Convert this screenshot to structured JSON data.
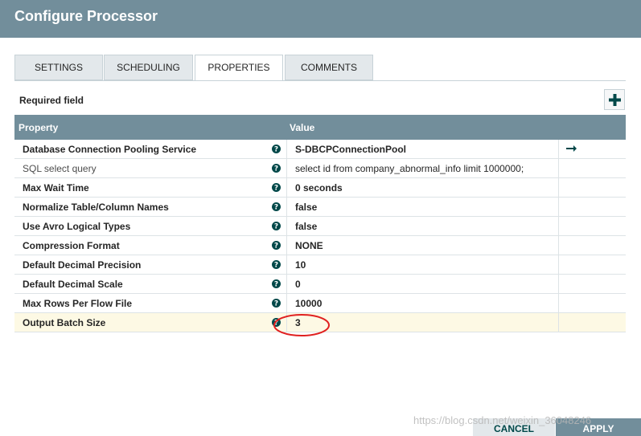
{
  "dialog": {
    "title": "Configure Processor"
  },
  "tabs": [
    {
      "label": "SETTINGS"
    },
    {
      "label": "SCHEDULING"
    },
    {
      "label": "PROPERTIES",
      "active": true
    },
    {
      "label": "COMMENTS"
    }
  ],
  "properties_panel": {
    "required_label": "Required field",
    "columns": {
      "property": "Property",
      "value": "Value"
    },
    "rows": [
      {
        "name": "Database Connection Pooling Service",
        "value": "S-DBCPConnectionPool",
        "required": true
      },
      {
        "name": "SQL select query",
        "value": "select id from company_abnormal_info limit 1000000;",
        "required": false
      },
      {
        "name": "Max Wait Time",
        "value": "0 seconds",
        "required": true
      },
      {
        "name": "Normalize Table/Column Names",
        "value": "false",
        "required": true
      },
      {
        "name": "Use Avro Logical Types",
        "value": "false",
        "required": true
      },
      {
        "name": "Compression Format",
        "value": "NONE",
        "required": true
      },
      {
        "name": "Default Decimal Precision",
        "value": "10",
        "required": true
      },
      {
        "name": "Default Decimal Scale",
        "value": "0",
        "required": true
      },
      {
        "name": "Max Rows Per Flow File",
        "value": "10000",
        "required": true
      },
      {
        "name": "Output Batch Size",
        "value": "3",
        "required": true,
        "highlighted": true
      }
    ]
  },
  "footer": {
    "cancel_label": "CANCEL",
    "apply_label": "APPLY"
  },
  "watermark": "https://blog.csdn.net/weixin_36048246",
  "colors": {
    "header": "#728e9b",
    "accent": "#004849",
    "highlight_row": "#fdf9e4",
    "annotation": "#e02020"
  }
}
